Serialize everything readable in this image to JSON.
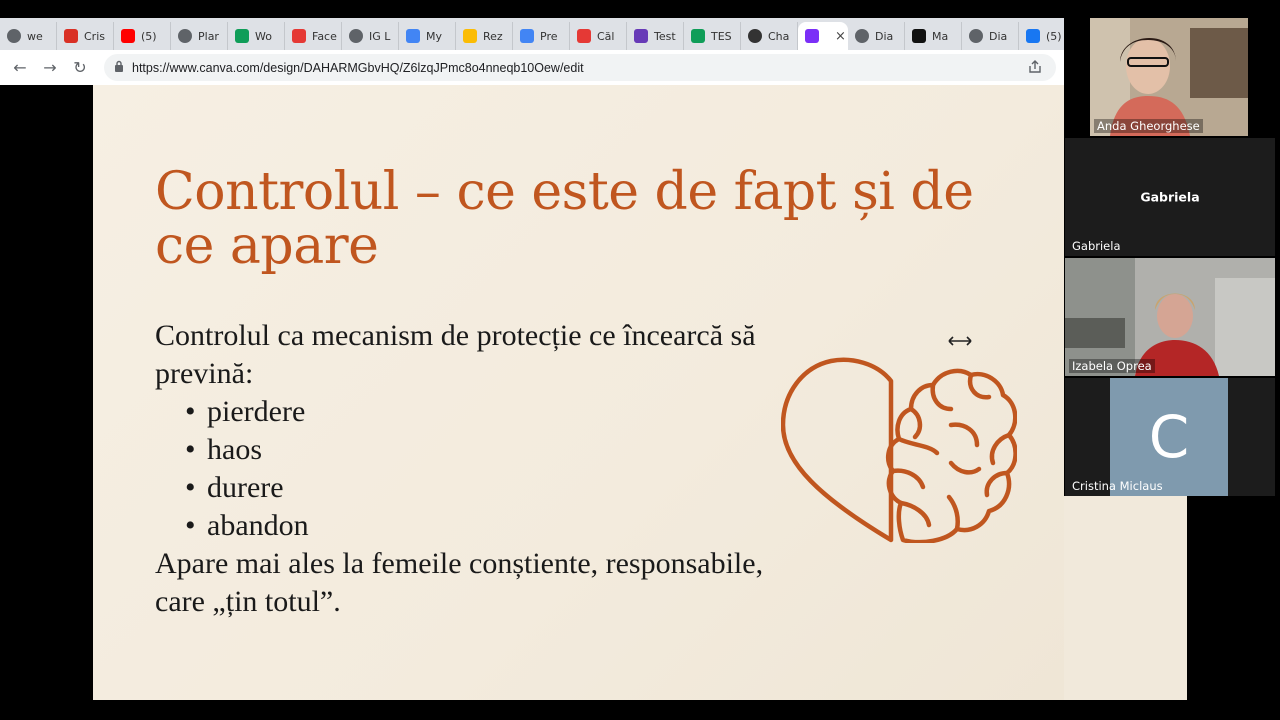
{
  "browser": {
    "tabs": [
      {
        "label": "we",
        "icon": "globe-icon",
        "color": "#5f6368"
      },
      {
        "label": "Cris",
        "icon": "gmail-icon",
        "color": "#d93025"
      },
      {
        "label": "(5)",
        "icon": "youtube-icon",
        "color": "#ff0000"
      },
      {
        "label": "Plar",
        "icon": "globe-icon",
        "color": "#5f6368"
      },
      {
        "label": "Wo",
        "icon": "sheets-icon",
        "color": "#0f9d58"
      },
      {
        "label": "Face",
        "icon": "flash-icon",
        "color": "#e53935"
      },
      {
        "label": "IG L",
        "icon": "globe-icon",
        "color": "#5f6368"
      },
      {
        "label": "My",
        "icon": "circle-icon",
        "color": "#4285f4"
      },
      {
        "label": "Rez",
        "icon": "drive-icon",
        "color": "#fbbc04"
      },
      {
        "label": "Pre",
        "icon": "docs-icon",
        "color": "#4285f4"
      },
      {
        "label": "Căl",
        "icon": "sk-icon",
        "color": "#e53935"
      },
      {
        "label": "Test",
        "icon": "forms-icon",
        "color": "#673ab7"
      },
      {
        "label": "TES",
        "icon": "sheets-icon",
        "color": "#0f9d58"
      },
      {
        "label": "Cha",
        "icon": "chatgpt-icon",
        "color": "#333333"
      },
      {
        "label": "",
        "icon": "canva-icon",
        "color": "#7b2ff7",
        "active": true,
        "close": "×"
      },
      {
        "label": "Dia",
        "icon": "globe-icon",
        "color": "#5f6368"
      },
      {
        "label": "Ma",
        "icon": "notion-icon",
        "color": "#111111"
      },
      {
        "label": "Dia",
        "icon": "globe-icon",
        "color": "#5f6368"
      },
      {
        "label": "(5)",
        "icon": "facebook-icon",
        "color": "#1877f2"
      }
    ],
    "url": "https://www.canva.com/design/DAHARMGbvHQ/Z6lzqJPmc8o4nneqb10Oew/edit",
    "back": "←",
    "forward": "→",
    "reload": "↻",
    "lock": "🔒",
    "share": "⇪"
  },
  "slide": {
    "title": "Controlul – ce este de fapt și de ce apare",
    "intro": "Controlul ca mecanism de protecție ce încearcă să prevină:",
    "bullets": [
      "pierdere",
      "haos",
      "durere",
      "abandon"
    ],
    "closing": "Apare mai ales la femeile conștiente, responsabile, care „țin totul”.",
    "accent_color": "#c0561f"
  },
  "participants": [
    {
      "name": "Anda Gheorghese",
      "video": true
    },
    {
      "name": "Gabriela",
      "center_label": "Gabriela",
      "video": false
    },
    {
      "name": "Izabela Oprea",
      "video": true
    },
    {
      "name": "Cristina Miclaus",
      "avatar_letter": "C",
      "avatar_color": "#7f9aae",
      "video": false
    }
  ]
}
